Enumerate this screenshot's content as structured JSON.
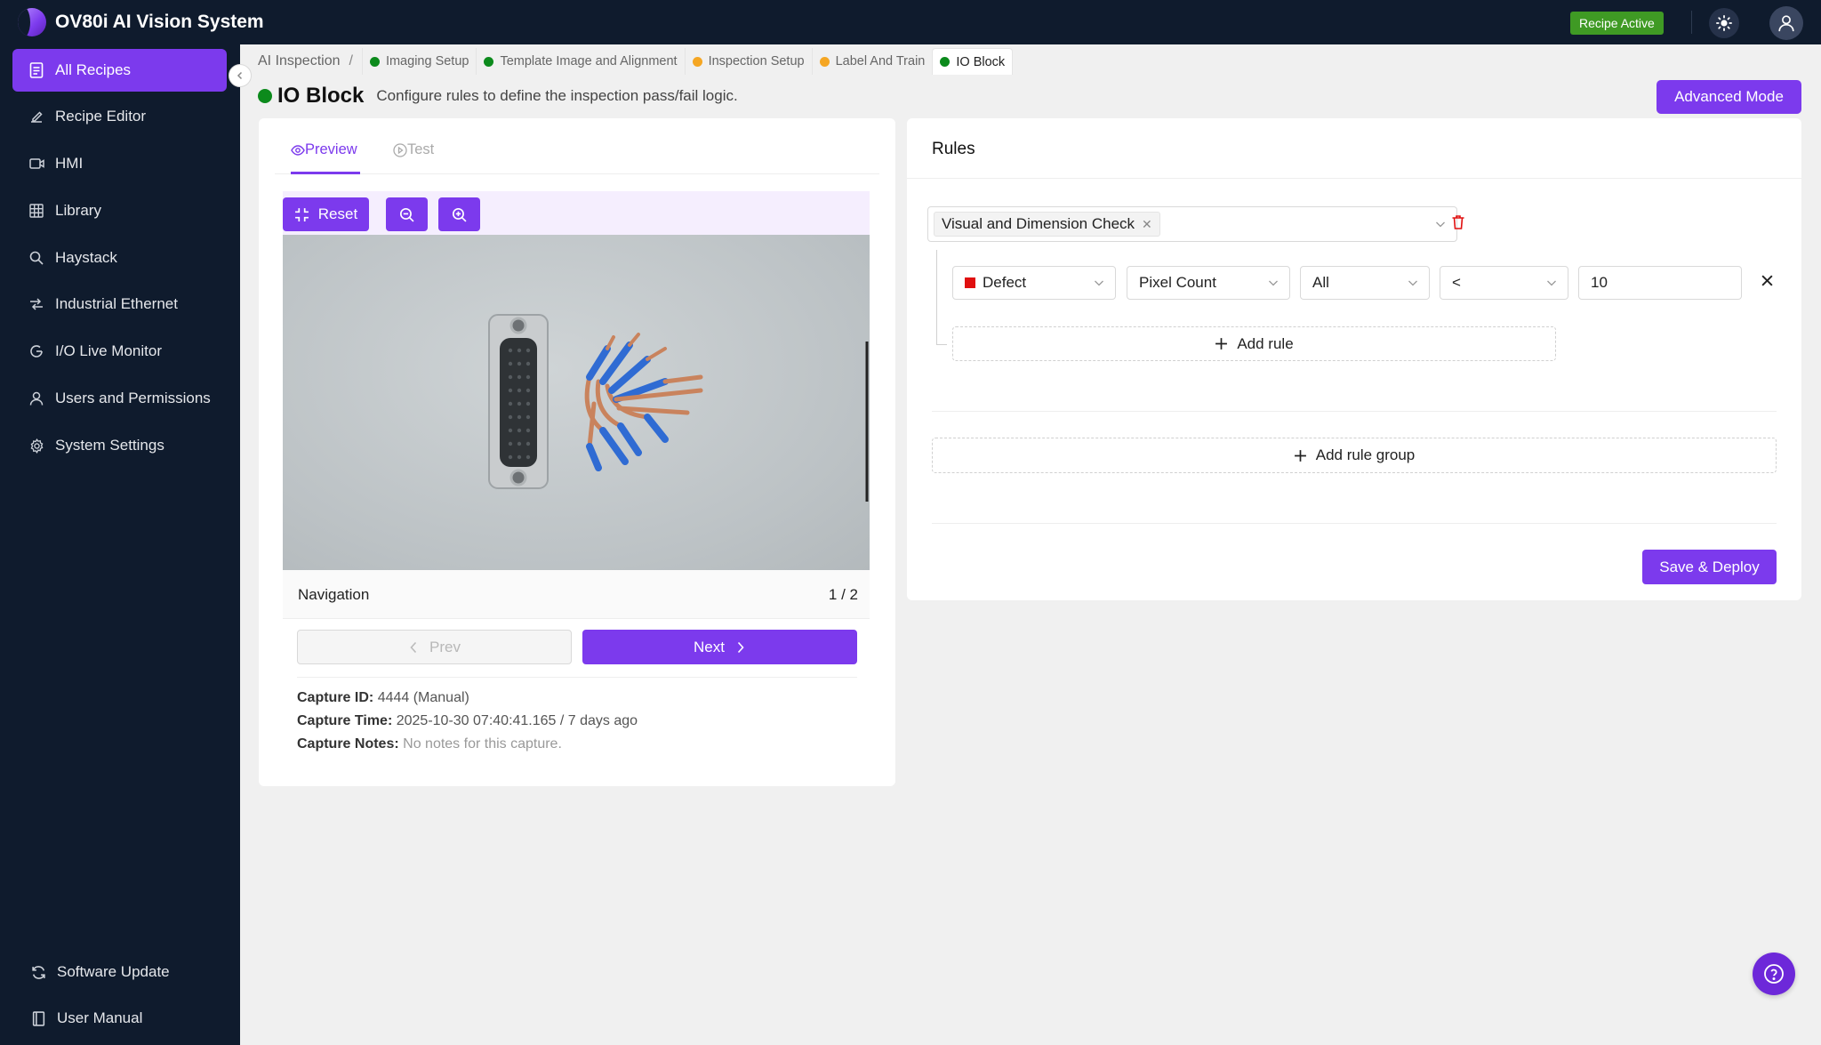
{
  "app": {
    "title": "OV80i AI Vision System",
    "status_badge": "Recipe Active"
  },
  "sidebar": {
    "items": [
      {
        "label": "All Recipes",
        "icon": "file-list-icon"
      },
      {
        "label": "Recipe Editor",
        "icon": "edit-icon"
      },
      {
        "label": "HMI",
        "icon": "camera-icon"
      },
      {
        "label": "Library",
        "icon": "grid-icon"
      },
      {
        "label": "Haystack",
        "icon": "search-icon"
      },
      {
        "label": "Industrial Ethernet",
        "icon": "ethernet-icon"
      },
      {
        "label": "I/O Live Monitor",
        "icon": "monitor-icon"
      },
      {
        "label": "Users and Permissions",
        "icon": "user-icon"
      },
      {
        "label": "System Settings",
        "icon": "gear-icon"
      }
    ],
    "footer": [
      {
        "label": "Software Update",
        "icon": "sync-icon"
      },
      {
        "label": "User Manual",
        "icon": "book-icon"
      }
    ]
  },
  "breadcrumb": {
    "root": "AI Inspection",
    "separator": "/",
    "steps": [
      {
        "label": "Imaging Setup",
        "status": "green"
      },
      {
        "label": "Template Image and Alignment",
        "status": "green"
      },
      {
        "label": "Inspection Setup",
        "status": "orange"
      },
      {
        "label": "Label And Train",
        "status": "orange"
      },
      {
        "label": "IO Block",
        "status": "green"
      }
    ]
  },
  "page": {
    "title": "IO Block",
    "description": "Configure rules to define the inspection pass/fail logic.",
    "advanced_button": "Advanced Mode"
  },
  "preview": {
    "tabs": {
      "preview": "Preview",
      "test": "Test"
    },
    "toolbar": {
      "reset": "Reset"
    },
    "navigation_label": "Navigation",
    "navigation_count": "1 / 2",
    "prev": "Prev",
    "next": "Next",
    "capture_id_label": "Capture ID:",
    "capture_id_value": "4444 (Manual)",
    "capture_time_label": "Capture Time:",
    "capture_time_value": "2025-10-30 07:40:41.165 / 7 days ago",
    "capture_notes_label": "Capture Notes:",
    "capture_notes_value": "No notes for this capture."
  },
  "rules": {
    "title": "Rules",
    "group_tag": "Visual and Dimension Check",
    "rule": {
      "class": "Defect",
      "class_color": "#e01010",
      "metric": "Pixel Count",
      "scope": "All",
      "operator": "<",
      "value": "10"
    },
    "add_rule": "Add rule",
    "add_rule_group": "Add rule group",
    "save_deploy": "Save & Deploy"
  },
  "colors": {
    "accent": "#7c3aed",
    "nav_bg": "#0f1b2d",
    "ok": "#0c8a1c",
    "warn": "#f5a623",
    "badge": "#3f9a24"
  }
}
